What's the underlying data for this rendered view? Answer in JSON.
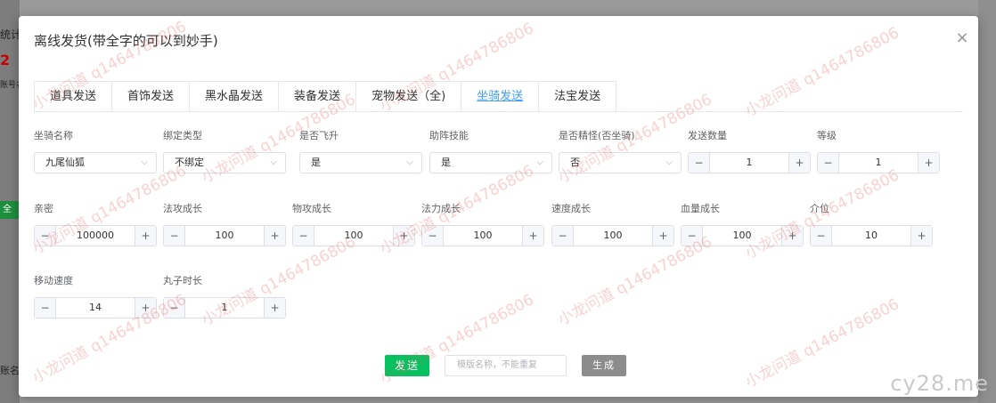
{
  "background": {
    "fragments": [
      "统计",
      "2",
      "账号名",
      "全部",
      "账名名"
    ]
  },
  "dialog": {
    "title": "离线发货(带全字的可以到妙手)",
    "close_glyph": "×"
  },
  "tabs": [
    {
      "label": "道具发送",
      "active": false
    },
    {
      "label": "首饰发送",
      "active": false
    },
    {
      "label": "黑水晶发送",
      "active": false
    },
    {
      "label": "装备发送",
      "active": false
    },
    {
      "label": "宠物发送（全)",
      "active": false
    },
    {
      "label": "坐骑发送",
      "active": true
    },
    {
      "label": "法宝发送",
      "active": false
    }
  ],
  "selects": [
    {
      "label": "坐骑名称",
      "value": "九尾仙狐"
    },
    {
      "label": "绑定类型",
      "value": "不绑定"
    },
    {
      "label": "是否飞升",
      "value": "是"
    },
    {
      "label": "助阵技能",
      "value": "是"
    },
    {
      "label": "是否精怪(否坐骑)",
      "value": "否"
    }
  ],
  "steppers": [
    {
      "label": "发送数量",
      "value": "1"
    },
    {
      "label": "等级",
      "value": "1"
    },
    {
      "label": "亲密",
      "value": "100000"
    },
    {
      "label": "法攻成长",
      "value": "100"
    },
    {
      "label": "物攻成长",
      "value": "100"
    },
    {
      "label": "法力成长",
      "value": "100"
    },
    {
      "label": "速度成长",
      "value": "100"
    },
    {
      "label": "血量成长",
      "value": "100"
    },
    {
      "label": "介位",
      "value": "10"
    },
    {
      "label": "移动速度",
      "value": "14"
    },
    {
      "label": "丸子时长",
      "value": "1"
    }
  ],
  "stepper_minus": "−",
  "stepper_plus": "+",
  "select_caret": "⌵",
  "footer": {
    "send_label": "发送",
    "template_placeholder": "模版名称，不能重复",
    "generate_label": "生成"
  },
  "watermark": "小龙问道 q1464786806",
  "brand": "cy28.me"
}
